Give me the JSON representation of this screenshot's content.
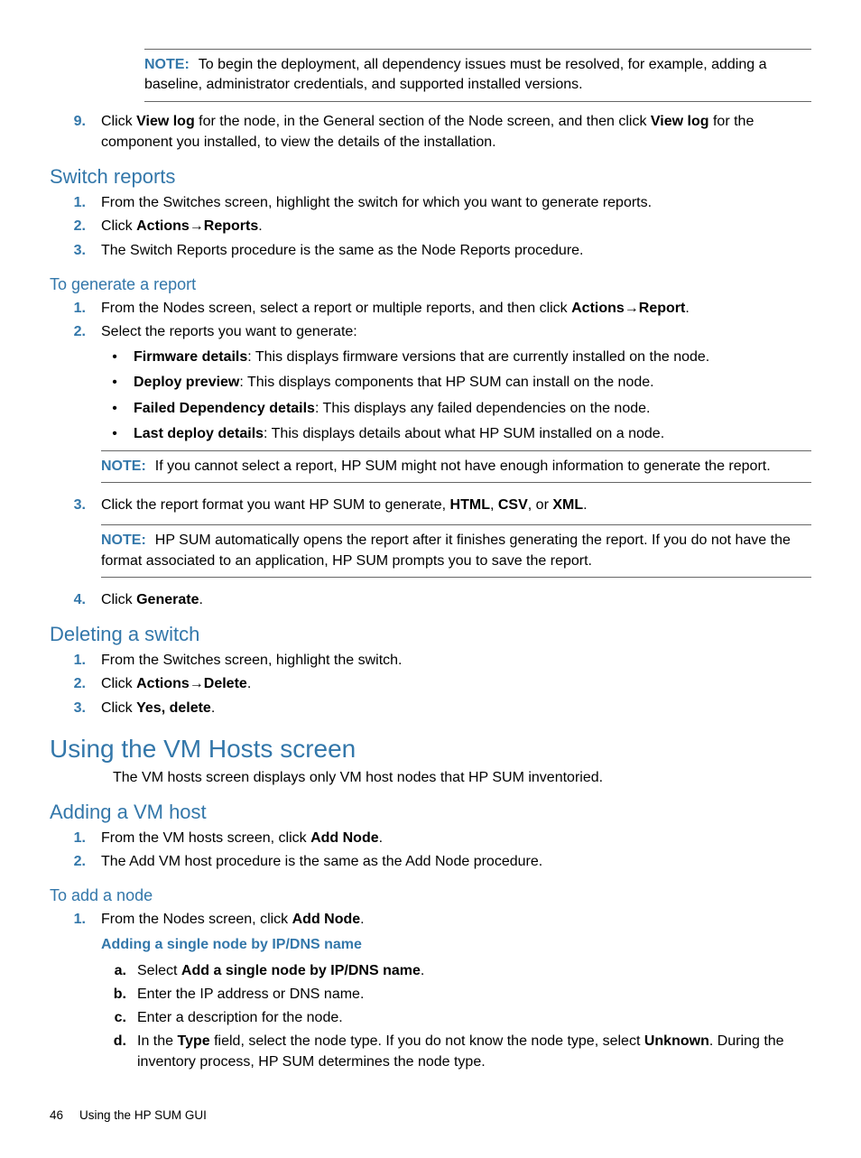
{
  "note1_label": "NOTE:",
  "note1_text": "To begin the deployment, all dependency issues must be resolved, for example, adding a baseline, administrator credentials, and supported installed versions.",
  "step9_num": "9.",
  "step9_a": "Click ",
  "step9_b1": "View log",
  "step9_c": " for the node, in the General section of the Node screen, and then click ",
  "step9_b2": "View log",
  "step9_d": " for the component you installed, to view the details of the installation.",
  "h_switch_reports": "Switch reports",
  "sr1_num": "1.",
  "sr1_text": "From the Switches screen, highlight the switch for which you want to generate reports.",
  "sr2_num": "2.",
  "sr2_a": "Click ",
  "sr2_b1": "Actions",
  "sr2_arrow": "→",
  "sr2_b2": "Reports",
  "sr2_c": ".",
  "sr3_num": "3.",
  "sr3_text": "The Switch Reports procedure is the same as the Node Reports procedure.",
  "h_generate": "To generate a report",
  "gr1_num": "1.",
  "gr1_a": "From the Nodes screen, select a report or multiple reports, and then click ",
  "gr1_b1": "Actions",
  "gr1_arrow": "→",
  "gr1_b2": "Report",
  "gr1_c": ".",
  "gr2_num": "2.",
  "gr2_text": "Select the reports you want to generate:",
  "b1_b": "Firmware details",
  "b1_t": ": This displays firmware versions that are currently installed on the node.",
  "b2_b": "Deploy preview",
  "b2_t": ": This displays components that HP SUM can install on the node.",
  "b3_b": "Failed Dependency details",
  "b3_t": ": This displays any failed dependencies on the node.",
  "b4_b": "Last deploy details",
  "b4_t": ": This displays details about what HP SUM installed on a node.",
  "note2_label": "NOTE:",
  "note2_text": "If you cannot select a report, HP SUM might not have enough information to generate the report.",
  "gr3_num": "3.",
  "gr3_a": "Click the report format you want HP SUM to generate, ",
  "gr3_b1": "HTML",
  "gr3_s1": ", ",
  "gr3_b2": "CSV",
  "gr3_s2": ", or ",
  "gr3_b3": "XML",
  "gr3_c": ".",
  "note3_label": "NOTE:",
  "note3_text": "HP SUM automatically opens the report after it finishes generating the report. If you do not have the format associated to an application, HP SUM prompts you to save the report.",
  "gr4_num": "4.",
  "gr4_a": "Click ",
  "gr4_b": "Generate",
  "gr4_c": ".",
  "h_delete": "Deleting a switch",
  "ds1_num": "1.",
  "ds1_text": "From the Switches screen, highlight the switch.",
  "ds2_num": "2.",
  "ds2_a": "Click ",
  "ds2_b1": "Actions",
  "ds2_arrow": "→",
  "ds2_b2": "Delete",
  "ds2_c": ".",
  "ds3_num": "3.",
  "ds3_a": "Click ",
  "ds3_b": "Yes, delete",
  "ds3_c": ".",
  "h_vm": "Using the VM Hosts screen",
  "vm_text": "The VM hosts screen displays only VM host nodes that HP SUM inventoried.",
  "h_addvm": "Adding a VM host",
  "av1_num": "1.",
  "av1_a": "From the VM hosts screen, click ",
  "av1_b": "Add Node",
  "av1_c": ".",
  "av2_num": "2.",
  "av2_text": "The Add VM host procedure is the same as the Add Node procedure.",
  "h_addnode": "To add a node",
  "an1_num": "1.",
  "an1_a": "From the Nodes screen, click ",
  "an1_b": "Add Node",
  "an1_c": ".",
  "h_single": "Adding a single node by IP/DNS name",
  "al_a_num": "a.",
  "al_a_a": "Select ",
  "al_a_b": "Add a single node by IP/DNS name",
  "al_a_c": ".",
  "al_b_num": "b.",
  "al_b_text": "Enter the IP address or DNS name.",
  "al_c_num": "c.",
  "al_c_text": "Enter a description for the node.",
  "al_d_num": "d.",
  "al_d_a": "In the ",
  "al_d_b1": "Type",
  "al_d_m": " field, select the node type. If you do not know the node type, select ",
  "al_d_b2": "Unknown",
  "al_d_c": ". During the inventory process, HP SUM determines the node type.",
  "footer_pg": "46",
  "footer_text": "Using the HP SUM GUI"
}
